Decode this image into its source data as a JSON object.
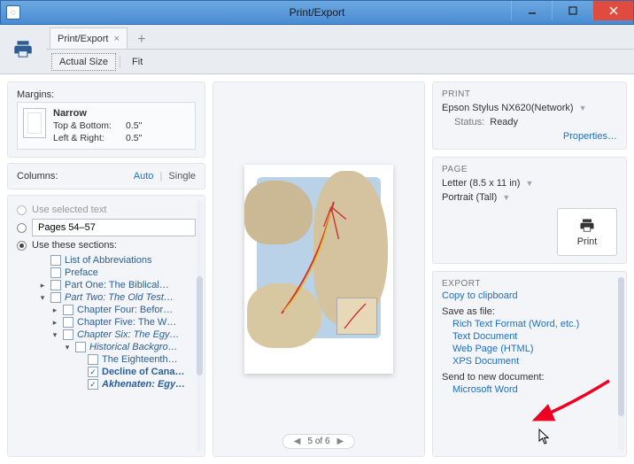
{
  "window": {
    "title": "Print/Export"
  },
  "doc_tab": {
    "label": "Print/Export"
  },
  "view": {
    "actual": "Actual Size",
    "fit": "Fit"
  },
  "margins": {
    "head": "Margins:",
    "name": "Narrow",
    "tb_lbl": "Top & Bottom:",
    "tb_val": "0.5\"",
    "lr_lbl": "Left & Right:",
    "lr_val": "0.5\""
  },
  "columns": {
    "head": "Columns:",
    "auto": "Auto",
    "single": "Single"
  },
  "source": {
    "use_selected": "Use selected text",
    "pages_value": "Pages 54–57",
    "use_sections": "Use these sections:"
  },
  "tree": {
    "abbrev": "List of Abbreviations",
    "preface": "Preface",
    "part1": "Part One: The Biblical…",
    "part2": "Part Two: The Old Test…",
    "ch4": "Chapter Four: Befor…",
    "ch5": "Chapter Five: The W…",
    "ch6": "Chapter Six: The Egy…",
    "hist": "Historical Backgro…",
    "eighteenth": "The Eighteenth…",
    "decline": "Decline of Cana…",
    "akhen": "Akhenaten: Egy…"
  },
  "pager": {
    "text": "5 of 6"
  },
  "print": {
    "head": "PRINT",
    "printer": "Epson Stylus NX620(Network)",
    "status_lbl": "Status:",
    "status_val": "Ready",
    "props": "Properties…",
    "btn": "Print"
  },
  "page_panel": {
    "head": "PAGE",
    "size": "Letter (8.5 x 11 in)",
    "orient": "Portrait (Tall)"
  },
  "export": {
    "head": "EXPORT",
    "clip": "Copy to clipboard",
    "save_as": "Save as file:",
    "rtf": "Rich Text Format (Word, etc.)",
    "txt": "Text Document",
    "html": "Web Page (HTML)",
    "xps": "XPS Document",
    "send_to": "Send to new document:",
    "word": "Microsoft Word"
  }
}
